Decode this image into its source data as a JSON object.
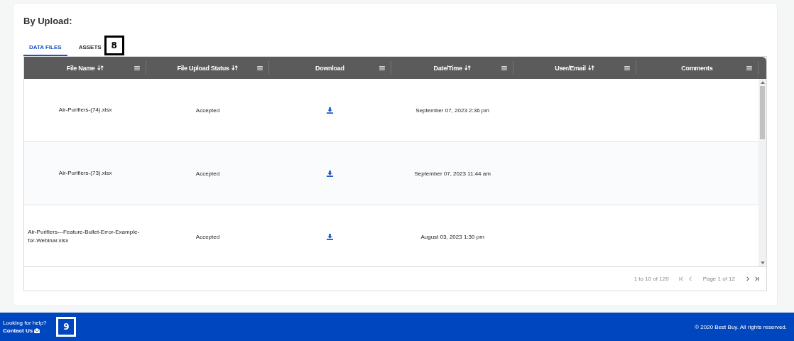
{
  "section_title": "By Upload:",
  "tabs": [
    {
      "label": "DATA FILES",
      "selected": true
    },
    {
      "label": "ASSETS",
      "selected": false
    }
  ],
  "tabs_callout": "8",
  "table": {
    "columns": [
      {
        "label": "File Name",
        "sortable": true
      },
      {
        "label": "File Upload Status",
        "sortable": true
      },
      {
        "label": "Download",
        "sortable": false
      },
      {
        "label": "Date/Time",
        "sortable": true
      },
      {
        "label": "User/Email",
        "sortable": true
      },
      {
        "label": "Comments",
        "sortable": false
      }
    ],
    "rows": [
      {
        "file_name": "Air-Purifiers-(74).xlsx",
        "status": "Accepted",
        "date_time": "September 07, 2023 2:36 pm"
      },
      {
        "file_name": "Air-Purifiers-(73).xlsx",
        "status": "Accepted",
        "date_time": "September 07, 2023 11:44 am"
      },
      {
        "file_name": "Air-Purifiers---Feature-Bullet-Error-Example-for-Webinar.xlsx",
        "status": "Accepted",
        "date_time": "August 03, 2023 1:30 pm"
      }
    ]
  },
  "pagination": {
    "summary": "1 to 10 of 120",
    "page": "Page 1 of 12"
  },
  "footer": {
    "help": "Looking for help?",
    "contact": "Contact Us",
    "callout": "9",
    "copyright": "© 2020 Best Buy. All rights reserved."
  }
}
